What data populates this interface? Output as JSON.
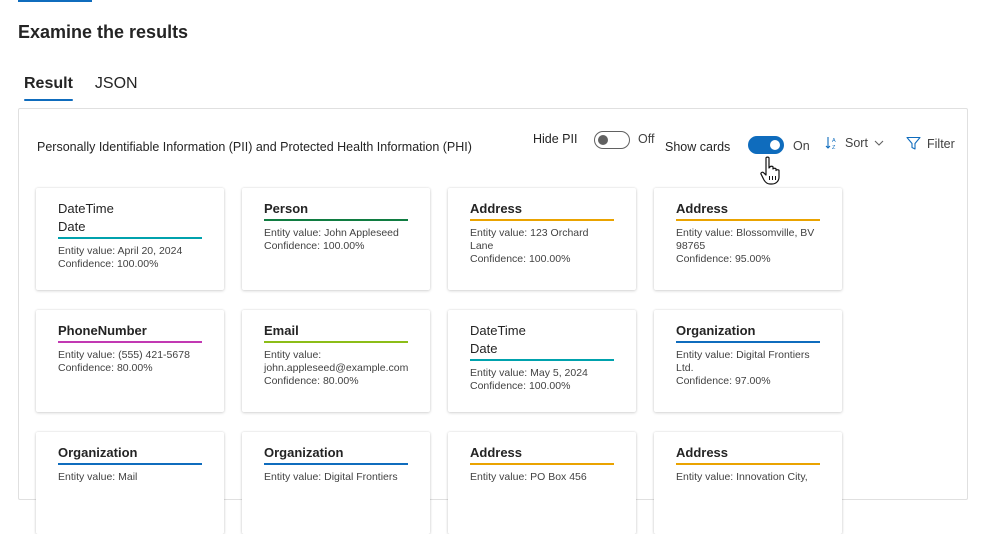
{
  "heading": "Examine the results",
  "tabs": [
    {
      "label": "Result",
      "active": true
    },
    {
      "label": "JSON",
      "active": false
    }
  ],
  "toolbar": {
    "title": "Personally Identifiable Information (PII) and Protected Health Information (PHI)",
    "hide_pii_label": "Hide PII",
    "hide_pii_state": "Off",
    "show_cards_label": "Show cards",
    "show_cards_state": "On",
    "sort_label": "Sort",
    "filter_label": "Filter"
  },
  "colors": {
    "DateTime": "#00a2ad",
    "Person": "#107c41",
    "Address": "#eaa300",
    "PhoneNumber": "#c239b3",
    "Email": "#8cbd18",
    "Organization": "#0f6cbd"
  },
  "cards": [
    {
      "category": "DateTime",
      "subcategory": "Date",
      "value_line": "Entity value: April 20, 2024",
      "confidence": "Confidence: 100.00%",
      "color": "#00a2ad"
    },
    {
      "category": "Person",
      "subcategory": "",
      "value_line": "Entity value: John Appleseed",
      "confidence": "Confidence: 100.00%",
      "color": "#107c41"
    },
    {
      "category": "Address",
      "subcategory": "",
      "value_line": "Entity value: 123 Orchard Lane",
      "confidence": "Confidence: 100.00%",
      "color": "#eaa300"
    },
    {
      "category": "Address",
      "subcategory": "",
      "value_line": "Entity value: Blossomville, BV 98765",
      "confidence": "Confidence: 95.00%",
      "color": "#eaa300"
    },
    {
      "category": "PhoneNumber",
      "subcategory": "",
      "value_line": "Entity value: (555) 421-5678",
      "confidence": "Confidence: 80.00%",
      "color": "#c239b3"
    },
    {
      "category": "Email",
      "subcategory": "",
      "value_line": "Entity value: john.appleseed@example.com",
      "confidence": "Confidence: 80.00%",
      "color": "#8cbd18"
    },
    {
      "category": "DateTime",
      "subcategory": "Date",
      "value_line": "Entity value: May 5, 2024",
      "confidence": "Confidence: 100.00%",
      "color": "#00a2ad"
    },
    {
      "category": "Organization",
      "subcategory": "",
      "value_line": "Entity value: Digital Frontiers Ltd.",
      "confidence": "Confidence: 97.00%",
      "color": "#0f6cbd"
    },
    {
      "category": "Organization",
      "subcategory": "",
      "value_line": "Entity value: Mail",
      "confidence": "",
      "color": "#0f6cbd"
    },
    {
      "category": "Organization",
      "subcategory": "",
      "value_line": "Entity value: Digital Frontiers",
      "confidence": "",
      "color": "#0f6cbd"
    },
    {
      "category": "Address",
      "subcategory": "",
      "value_line": "Entity value: PO Box 456",
      "confidence": "",
      "color": "#eaa300"
    },
    {
      "category": "Address",
      "subcategory": "",
      "value_line": "Entity value: Innovation City,",
      "confidence": "",
      "color": "#eaa300"
    }
  ]
}
